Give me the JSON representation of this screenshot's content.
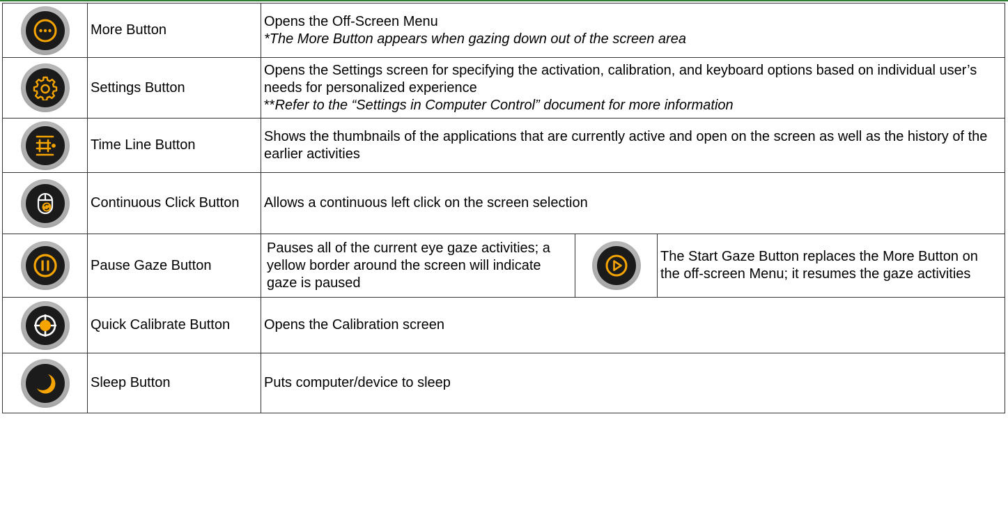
{
  "colors": {
    "accent": "#f5a400",
    "icon_bg": "#1b1b1b",
    "ring": "#a9a9a9",
    "top_border": "#2f7d32"
  },
  "rows": [
    {
      "icon": "more-icon",
      "name": "More Button",
      "desc": "Opens the Off-Screen Menu",
      "note": "*The More Button appears when gazing down out of the screen area"
    },
    {
      "icon": "gear-icon",
      "name": "Settings Button",
      "desc": "Opens the Settings screen for specifying the activation, calibration, and keyboard options based on individual user’s needs for personalized experience",
      "note_prefix": "**",
      "note": "Refer to the “Settings in Computer Control” document for more information"
    },
    {
      "icon": "timeline-icon",
      "name": "Time Line Button",
      "desc": "Shows the thumbnails of the applications that are currently active and open on the screen as well as the history of the earlier activities"
    },
    {
      "icon": "mouse-click-icon",
      "name": "Continuous Click Button",
      "desc": "Allows a continuous left click on the screen selection"
    },
    {
      "icon": "pause-icon",
      "name": "Pause Gaze Button",
      "desc": "Pauses all of the current eye gaze activities; a yellow border around the screen will indicate gaze is paused",
      "extra_icon": "play-icon",
      "extra_desc": "The Start Gaze Button replaces the More Button on the off-screen Menu; it resumes the gaze activities"
    },
    {
      "icon": "target-icon",
      "name": "Quick Calibrate Button",
      "desc": "Opens the Calibration screen"
    },
    {
      "icon": "moon-icon",
      "name": "Sleep Button",
      "desc": "Puts computer/device to sleep"
    }
  ]
}
